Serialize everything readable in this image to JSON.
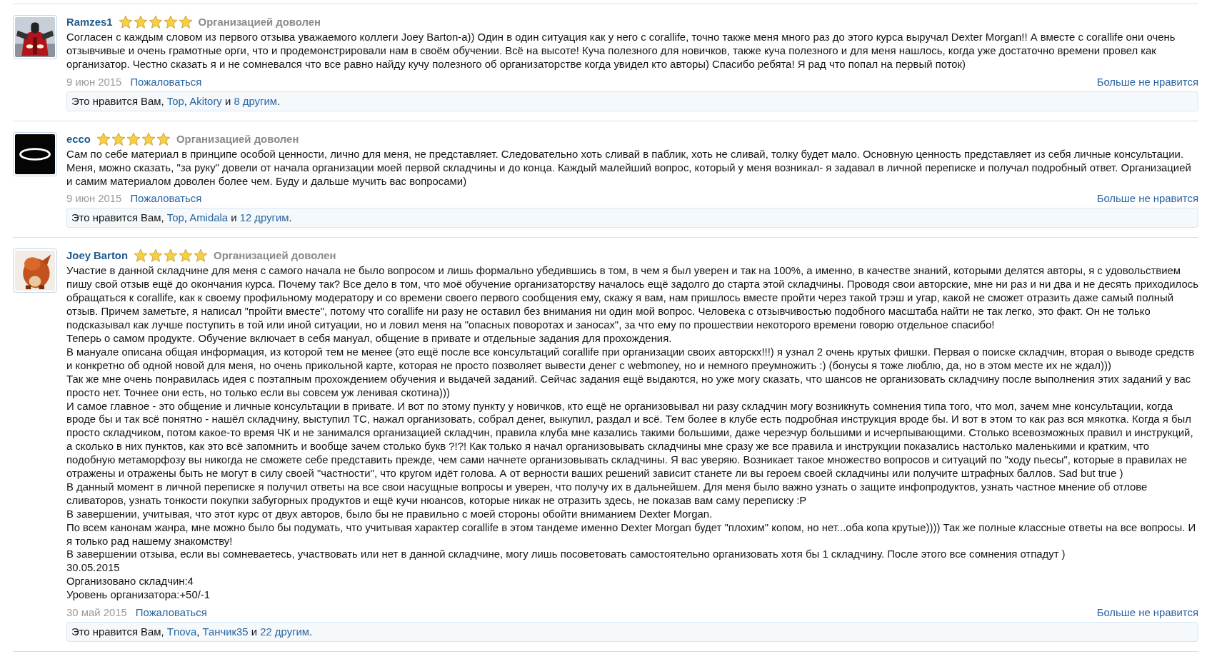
{
  "reviews": [
    {
      "author": "Ramzes1",
      "stars": 5,
      "rating_label": "Организацией доволен",
      "body": [
        "Согласен с каждым словом из первого отзыва уважаемого коллеги Joey Barton-а)) Один в один ситуация как у него с corallife, точно также меня много раз до этого курса выручал Dexter Morgan!! А вместе с corallife они очень отзывчивые и очень грамотные орги, что и продемонстрировали нам в своём обучении. Всё на высоте! Куча полезного для новичков, также куча полезного и для меня нашлось, когда уже достаточно времени провел как организатор. Честно сказать я и не сомневался что все равно найду кучу полезного об организаторстве когда увидел кто авторы) Спасибо ребята! Я рад что попал на первый поток)"
      ],
      "date": "9 июн 2015",
      "report": "Пожаловаться",
      "unlike": "Больше не нравится",
      "likes": [
        {
          "kind": "text",
          "text": "Это нравится Вам, "
        },
        {
          "kind": "link",
          "text": "Top"
        },
        {
          "kind": "text",
          "text": ", "
        },
        {
          "kind": "link",
          "text": "Akitory"
        },
        {
          "kind": "text",
          "text": " и "
        },
        {
          "kind": "link",
          "text": "8 другим"
        },
        {
          "kind": "text",
          "text": "."
        }
      ]
    },
    {
      "author": "ecco",
      "stars": 5,
      "rating_label": "Организацией доволен",
      "body": [
        "Сам по себе материал в принципе особой ценности, лично для меня, не представляет. Следовательно хоть сливай в паблик, хоть не сливай, толку будет мало. Основную ценность представляет из себя личные консультации. Меня, можно сказать, \"за руку\" довели от начала организации моей первой складчины и до конца. Каждый малейший вопрос, который у меня возникал- я задавал в личной переписке и получал подробный ответ. Организацией и самим материалом доволен более чем. Буду и дальше мучить вас вопросами)"
      ],
      "date": "9 июн 2015",
      "report": "Пожаловаться",
      "unlike": "Больше не нравится",
      "likes": [
        {
          "kind": "text",
          "text": "Это нравится Вам, "
        },
        {
          "kind": "link",
          "text": "Top"
        },
        {
          "kind": "text",
          "text": ", "
        },
        {
          "kind": "link",
          "text": "Amidala"
        },
        {
          "kind": "text",
          "text": " и "
        },
        {
          "kind": "link",
          "text": "12 другим"
        },
        {
          "kind": "text",
          "text": "."
        }
      ]
    },
    {
      "author": "Joey Barton",
      "stars": 5,
      "rating_label": "Организацией доволен",
      "body": [
        "Участие в данной складчине для меня с самого начала не было вопросом и лишь формально убедившись в том, в чем я был уверен и так на 100%, а именно, в качестве знаний, которыми делятся авторы, я с удовольствием пишу свой отзыв ещё до окончания курса. Почему так? Все дело в том, что моё обучение организаторству началось ещё задолго до старта этой складчины. Проводя свои авторские, мне ни раз и ни два и не десять приходилось обращаться к corallife, как к своему профильному модератору и со времени своего первого сообщения ему, скажу я вам, нам пришлось вместе пройти через такой трэш и угар, какой не сможет отразить даже самый полный отзыв. Причем заметьте, я написал \"пройти вместе\", потому что corallife ни разу не оставил без внимания ни один мой вопрос. Человека с отзывчивостью подобного масштаба найти не так легко, это факт. Он не только подсказывал как лучше поступить в той или иной ситуации, но и ловил меня на \"опасных поворотах и заносах\", за что ему по прошествии некоторого времени говорю отдельное спасибо!",
        "Теперь о самом продукте. Обучение включает в себя мануал, общение в привате и отдельные задания для прохождения.",
        "В мануале описана общая информация, из которой тем не менее (это ещё после все консультаций corallife при организации своих авторскх!!!) я узнал 2 очень крутых фишки. Первая о поиске складчин, вторая о выводе средств и конкретно об одной новой для меня, но очень прикольной карте, которая не просто позволяет вывести денег с webmoney, но и немного преумножить :) (бонусы я тоже люблю, да, но в этом месте их не ждал)))",
        "Так же мне очень понравилась идея с поэтапным прохождением обучения и выдачей заданий. Сейчас задания ещё выдаются, но уже могу сказать, что шансов не организовать складчину после выполнения этих заданий у вас просто нет. Точнее они есть, но только если вы совсем уж ленивая скотина)))",
        "И самое главное - это общение и личные консультации в привате. И вот по этому пункту у новичков, кто ещё не организовывал ни разу складчин могу возникнуть сомнения типа того, что мол, зачем мне консультации, когда вроде бы и так всё понятно - нашёл складчину, выступил ТС, нажал организовать, собрал денег, выкупил, раздал и всё. Тем более в клубе есть подробная инструкция вроде бы. И вот в этом то как раз вся мякотка. Когда я был просто складчиком, потом какое-то время ЧК и не занимался организацией складчин, правила клуба мне казались такими большими, даже черезчур большими и исчерпывающими. Столько всевозможных правил и инструкций, а сколько в них пунктов, как это всё запомнить и вообще зачем столько букв ?!?! Как только я начал организовывать складчины мне сразу же все правила и инструкции показались настолько маленькими и кратким, что подобную метаморфозу вы никогда не сможете себе представить прежде, чем сами начнете организовывать складчины. Я вас уверяю. Возникает такое множество вопросов и ситуаций по \"ходу пьесы\", которые в правилах не отражены и отражены быть не могут в силу своей \"частности\", что кругом идёт голова. А от верности ваших решений зависит станете ли вы героем своей складчины или получите штрафных баллов. Sad but true )",
        "В данный момент в личной переписке я получил ответы на все свои насущные вопросы и уверен, что получу их в дальнейшем. Для меня было важно узнать о защите инфопродуктов, узнать частное мнение об отлове сливаторов, узнать тонкости покупки забугорных продуктов и ещё кучи нюансов, которые никак не отразить здесь, не показав вам саму переписку :P",
        "В завершении, учитывая, что этот курс от двух авторов, было бы не правильно с моей стороны обойти вниманием Dexter Morgan.",
        "По всем канонам жанра, мне можно было бы подумать, что учитывая характер corallife в этом тандеме именно Dexter Morgan будет \"плохим\" копом, но нет...оба копа крутые)))) Так же полные классные ответы на все вопросы. И я только рад нашему знакомству!",
        "В завершении отзыва, если вы сомневаетесь, участвовать или нет в данной складчине, могу лишь посоветовать самостоятельно организовать хотя бы 1 складчину. После этого все сомнения отпадут )",
        "30.05.2015",
        "Организовано складчин:4",
        "Уровень организатора:+50/-1"
      ],
      "date": "30 май 2015",
      "report": "Пожаловаться",
      "unlike": "Больше не нравится",
      "likes": [
        {
          "kind": "text",
          "text": "Это нравится Вам, "
        },
        {
          "kind": "link",
          "text": "Tnova"
        },
        {
          "kind": "text",
          "text": ", "
        },
        {
          "kind": "link",
          "text": "Танчик35"
        },
        {
          "kind": "text",
          "text": " и "
        },
        {
          "kind": "link",
          "text": "22 другим"
        },
        {
          "kind": "text",
          "text": "."
        }
      ]
    }
  ]
}
